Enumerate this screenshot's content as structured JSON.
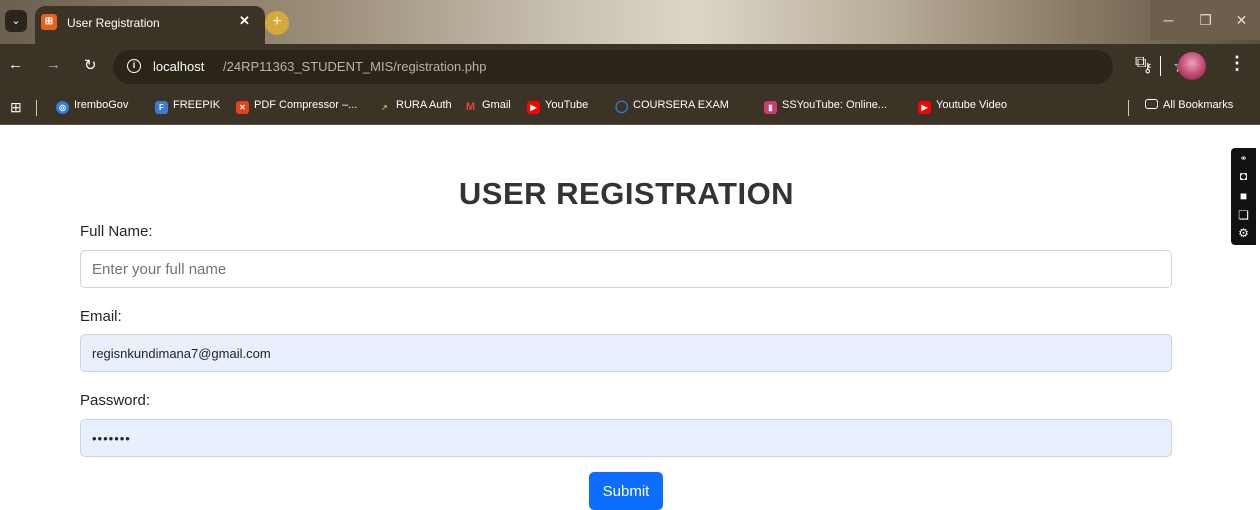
{
  "browser": {
    "tab_title": "User Registration",
    "url_host": "localhost",
    "url_path": "/24RP11363_STUDENT_MIS/registration.php",
    "bookmarks": [
      {
        "label": "IremboGov",
        "color": "#2f7de1",
        "glyph": "◎"
      },
      {
        "label": "FREEPIK",
        "color": "#3a7bd5",
        "glyph": "F"
      },
      {
        "label": "PDF Compressor –...",
        "color": "#e8401c",
        "glyph": "✕"
      },
      {
        "label": "RURA Auth",
        "color": "#3a3326",
        "glyph": "↗"
      },
      {
        "label": "Gmail",
        "color": "#3a3326",
        "glyph": "M"
      },
      {
        "label": "YouTube",
        "color": "#ff0000",
        "glyph": "▶"
      },
      {
        "label": "COURSERA EXAM",
        "color": "#3a3326",
        "glyph": "◯"
      },
      {
        "label": "SSYouTube: Online...",
        "color": "#d03a6f",
        "glyph": "▮"
      },
      {
        "label": "Youtube Video",
        "color": "#ff0000",
        "glyph": "▶"
      }
    ],
    "all_bookmarks": "All Bookmarks"
  },
  "form": {
    "title": "USER REGISTRATION",
    "full_name_label": "Full Name:",
    "full_name_placeholder": "Enter your full name",
    "email_label": "Email:",
    "email_value": "regisnkundimana7@gmail.com",
    "password_label": "Password:",
    "password_value": "•••••••",
    "submit_label": "Submit"
  },
  "colors": {
    "primary": "#0d6efd",
    "autofill_bg": "#e8f0fe"
  }
}
